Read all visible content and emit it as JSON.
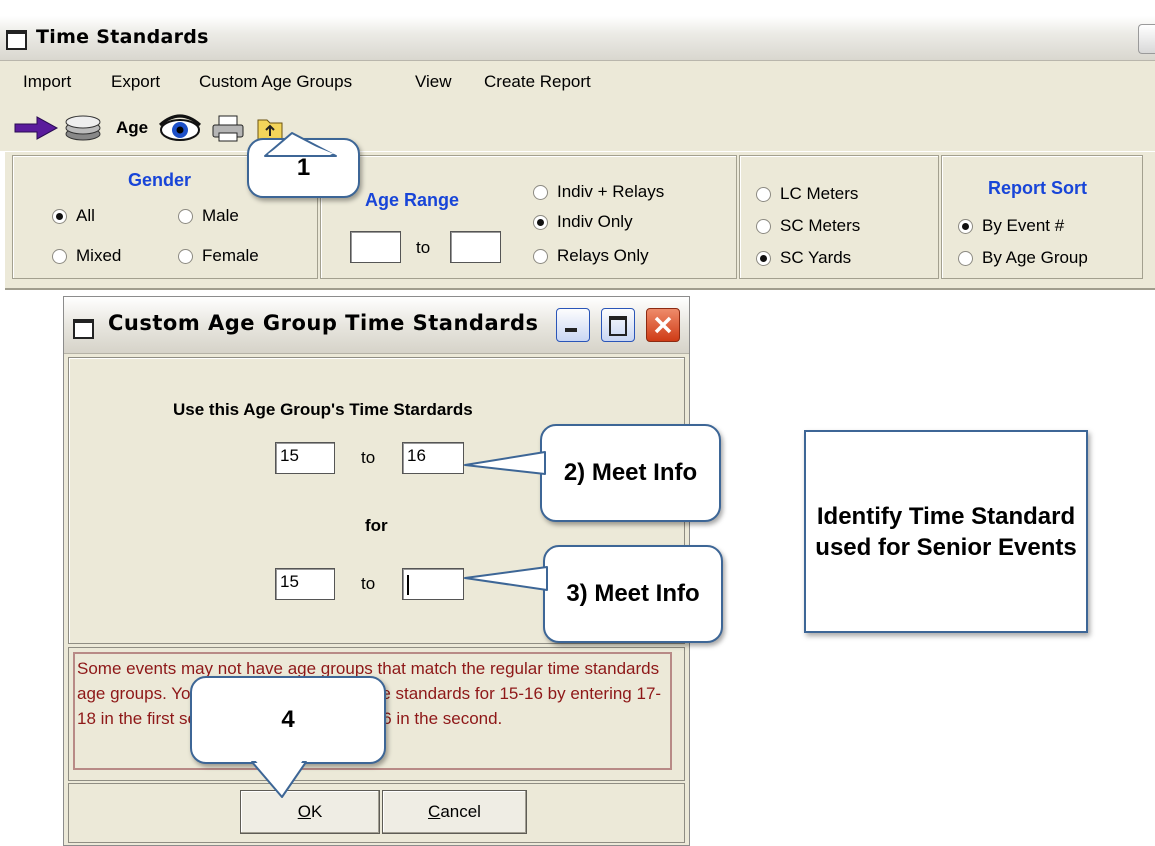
{
  "main_window": {
    "title": "Time Standards"
  },
  "menu": {
    "import": "Import",
    "export": "Export",
    "custom_age_groups": "Custom Age Groups",
    "view": "View",
    "create_report": "Create Report"
  },
  "toolbar": {
    "icons": [
      "arrow-right-icon",
      "stack-icon",
      "age-icon",
      "eye-icon",
      "printer-icon",
      "folder-icon"
    ],
    "age_label": "Age"
  },
  "options": {
    "gender": {
      "heading": "Gender",
      "all": "All",
      "male": "Male",
      "mixed": "Mixed",
      "female": "Female",
      "selected": "All"
    },
    "age_range": {
      "heading": "Age Range",
      "to": "to",
      "from_value": "",
      "to_value": ""
    },
    "event_type": {
      "indiv_relays": "Indiv + Relays",
      "indiv_only": "Indiv Only",
      "relays_only": "Relays Only",
      "selected": "Indiv Only"
    },
    "course": {
      "lc_meters": "LC Meters",
      "sc_meters": "SC Meters",
      "sc_yards": "SC Yards",
      "selected": "SC Yards"
    },
    "report_sort": {
      "heading": "Report Sort",
      "by_event": "By Event #",
      "by_age_group": "By Age Group",
      "selected": "By Event #"
    }
  },
  "dialog": {
    "title": "Custom Age Group Time Standards",
    "heading": "Use this Age Group's Time Stardards",
    "to1": "to",
    "for": "for",
    "to2": "to",
    "from1": "15",
    "until1": "16",
    "from2": "15",
    "until2": "",
    "message": "Some events may not have age groups that match the regular time standards age groups.  You could use the 17-18 time standards for 15-16 by entering 17-18 in the first set of age groups and 15-16 in the second.",
    "ok_prefix": "O",
    "ok_rest": "K",
    "cancel_prefix": "C",
    "cancel_rest": "ancel"
  },
  "callouts": {
    "c1": "1",
    "c2": "2) Meet Info",
    "c3": "3) Meet Info",
    "c4": "4",
    "info": "Identify Time Standard used for Senior Events"
  },
  "colors": {
    "panel": "#ece9d8",
    "heading_blue": "#1845d8",
    "message_red": "#8e1818",
    "callout_border": "#3d6696",
    "close_red": "#cf3b16"
  }
}
